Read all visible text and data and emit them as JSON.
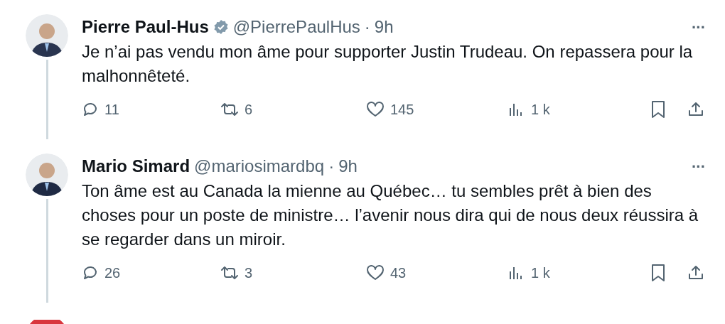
{
  "tweets": [
    {
      "name": "Pierre Paul-Hus",
      "verified": true,
      "handle": "@PierrePaulHus",
      "separator": "·",
      "time": "9h",
      "more": "···",
      "text": "Je n’ai pas vendu mon âme pour supporter Justin Trudeau. On repassera pour la malhonnêteté.",
      "replies": "11",
      "reposts": "6",
      "likes": "145",
      "views": "1 k"
    },
    {
      "name": "Mario Simard",
      "verified": false,
      "handle": "@mariosimardbq",
      "separator": "·",
      "time": "9h",
      "more": "···",
      "text": "Ton âme est au Canada la mienne au Québec… tu sembles prêt à bien des choses pour un poste de ministre… l’avenir nous dira qui de nous deux réussira à se regarder dans un miroir.",
      "replies": "26",
      "reposts": "3",
      "likes": "43",
      "views": "1 k"
    }
  ]
}
